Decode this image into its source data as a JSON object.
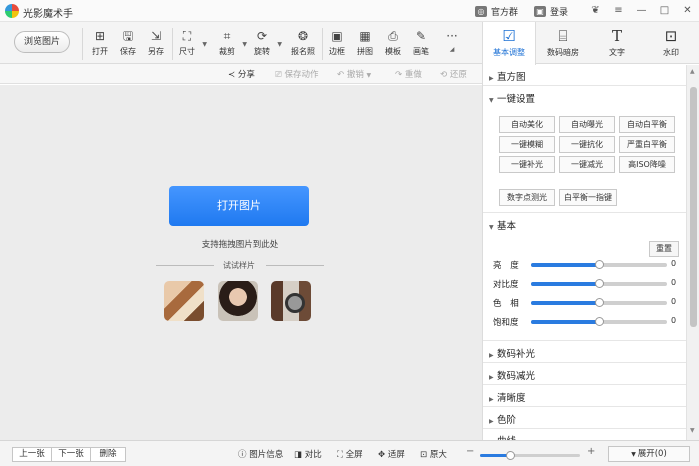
{
  "app": {
    "title": "光影魔术手",
    "links": {
      "community": "官方群",
      "login": "登录"
    },
    "window_controls": {
      "skin": "❦",
      "menu": "≡",
      "minimize": "—",
      "maximize": "□",
      "close": "✕"
    }
  },
  "toolbar": {
    "browse": "浏览图片",
    "tools": [
      {
        "label": "打开",
        "icon": "⊞"
      },
      {
        "label": "保存",
        "icon": "🖫"
      },
      {
        "label": "另存",
        "icon": "⇲"
      },
      {
        "label": "尺寸",
        "icon": "⛶"
      },
      {
        "label": "裁剪",
        "icon": "⌗"
      },
      {
        "label": "旋转",
        "icon": "⟳"
      },
      {
        "label": "报名照",
        "icon": "❂"
      },
      {
        "label": "边框",
        "icon": "▣"
      },
      {
        "label": "拼图",
        "icon": "▦"
      },
      {
        "label": "模板",
        "icon": "⎙"
      },
      {
        "label": "画笔",
        "icon": "✎"
      },
      {
        "label": "",
        "icon": "···"
      }
    ]
  },
  "right_tabs": [
    {
      "label": "基本调整",
      "icon": "☑",
      "active": true
    },
    {
      "label": "数码暗房",
      "icon": "⌸",
      "active": false
    },
    {
      "label": "文字",
      "icon": "T",
      "active": false
    },
    {
      "label": "水印",
      "icon": "⊡",
      "active": false
    }
  ],
  "actions": {
    "share": "分享",
    "save_action": "保存动作",
    "undo": "撤销",
    "redo": "重做",
    "restore": "还原"
  },
  "canvas": {
    "open_button": "打开图片",
    "drop_hint": "支持拖拽图片到此处",
    "samples_title": "试试样片"
  },
  "panel": {
    "sections": {
      "histogram": "直方图",
      "one_click": "一键设置",
      "basic": "基本",
      "fill_light": "数码补光",
      "reduce_light": "数码减光",
      "clarity": "清晰度",
      "levels": "色阶",
      "curves": "曲线"
    },
    "one_click_buttons": [
      "自动美化",
      "自动曝光",
      "自动白平衡",
      "一键模糊",
      "一键抗化",
      "严重白平衡",
      "一键补光",
      "一键减光",
      "高ISO降噪"
    ],
    "extra_buttons": [
      "数字点测光",
      "白平衡一指键"
    ],
    "reset": "重置",
    "sliders": [
      {
        "label": "亮  度",
        "value": "0",
        "level": 0.5
      },
      {
        "label": "对比度",
        "value": "0",
        "level": 0.5
      },
      {
        "label": "色  相",
        "value": "0",
        "level": 0.5
      },
      {
        "label": "饱和度",
        "value": "0",
        "level": 0.5
      }
    ]
  },
  "bottombar": {
    "prev": "上一张",
    "next": "下一张",
    "delete": "删除",
    "info": "图片信息",
    "compare": "对比",
    "fullscreen": "全屏",
    "fit": "适屏",
    "original": "原大",
    "zoom_minus": "−",
    "zoom_plus": "+",
    "zoom_level": 0.3,
    "expand": "展开(0)"
  },
  "colors": {
    "accent": "#1f79f0",
    "active_tab": "#1a6fd4"
  }
}
